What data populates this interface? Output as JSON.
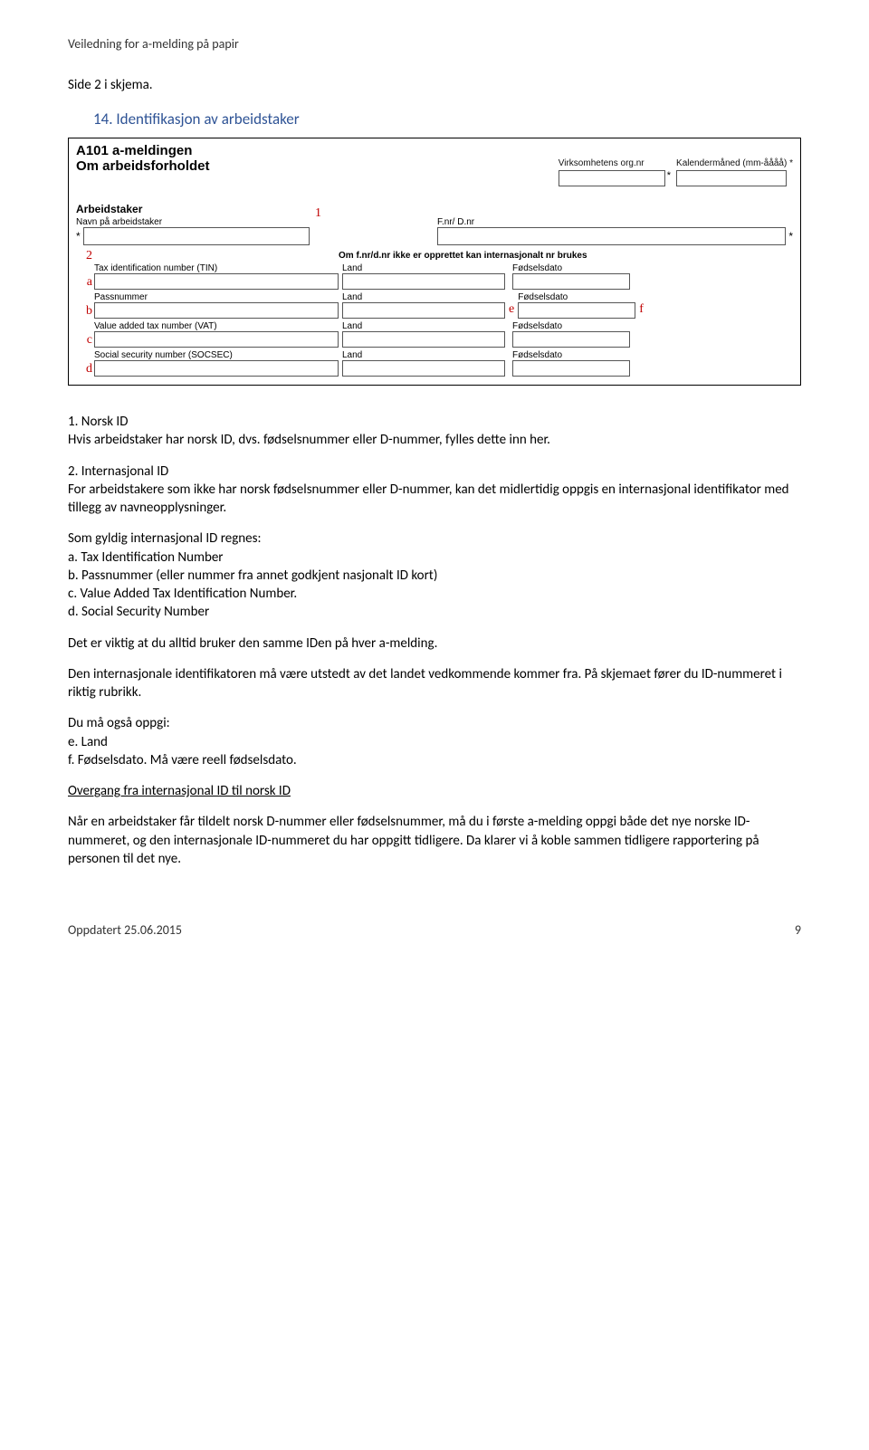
{
  "header": "Veiledning for a-melding på papir",
  "side_text": "Side 2 i skjema.",
  "heading": "14. Identifikasjon av arbeidstaker",
  "form": {
    "title": "A101  a-meldingen",
    "subtitle": "Om arbeidsforholdet",
    "orgnr_label": "Virksomhetens org.nr",
    "orgnr_ast": "*",
    "month_label": "Kalendermåned (mm-åååå) *",
    "arbeidstaker_label": "Arbeidstaker",
    "name_label": "Navn på arbeidstaker",
    "star": "*",
    "fnr_label": "F.nr/ D.nr",
    "intl_heading": "Om f.nr/d.nr ikke er opprettet kan internasjonalt nr brukes",
    "marker_1": "1",
    "marker_2": "2",
    "rows": [
      {
        "m": "a",
        "c1": "Tax identification number (TIN)",
        "c2": "Land",
        "c3": "Fødselsdato",
        "e": "",
        "f": ""
      },
      {
        "m": "b",
        "c1": "Passnummer",
        "c2": "Land",
        "c3": "Fødselsdato",
        "e": "e",
        "f": "f"
      },
      {
        "m": "c",
        "c1": "Value added tax number (VAT)",
        "c2": "Land",
        "c3": "Fødselsdato",
        "e": "",
        "f": ""
      },
      {
        "m": "d",
        "c1": "Social security number (SOCSEC)",
        "c2": "Land",
        "c3": "Fødselsdato",
        "e": "",
        "f": ""
      }
    ]
  },
  "body": {
    "h1": "1. Norsk ID",
    "p1": "Hvis arbeidstaker har norsk ID, dvs. fødselsnummer eller D-nummer, fylles dette inn her.",
    "h2": "2. Internasjonal ID",
    "p2": "For arbeidstakere som ikke har norsk fødselsnummer eller D-nummer, kan det midlertidig oppgis en internasjonal identifikator med tillegg av navneopplysninger.",
    "p3a": "Som gyldig internasjonal ID regnes:",
    "p3b": "a. Tax Identification Number",
    "p3c": "b. Passnummer (eller nummer fra annet godkjent nasjonalt ID kort)",
    "p3d": "c. Value Added Tax Identification Number.",
    "p3e": "d. Social Security Number",
    "p4": "Det er viktig at du alltid bruker den samme IDen på hver a-melding.",
    "p5": "Den internasjonale identifikatoren må være utstedt av det landet vedkommende kommer fra. På skjemaet fører du ID-nummeret i riktig rubrikk.",
    "p6a": "Du må også oppgi:",
    "p6b": "e. Land",
    "p6c": "f. Fødselsdato. Må være reell fødselsdato.",
    "h3": "Overgang fra internasjonal ID til norsk ID",
    "p7": "Når en arbeidstaker får tildelt norsk D-nummer eller fødselsnummer, må du i første a-melding oppgi både det nye norske ID-nummeret, og den internasjonale ID-nummeret du har oppgitt tidligere. Da klarer vi å koble sammen tidligere rapportering på personen til det nye."
  },
  "footer": {
    "left": "Oppdatert 25.06.2015",
    "right": "9"
  }
}
